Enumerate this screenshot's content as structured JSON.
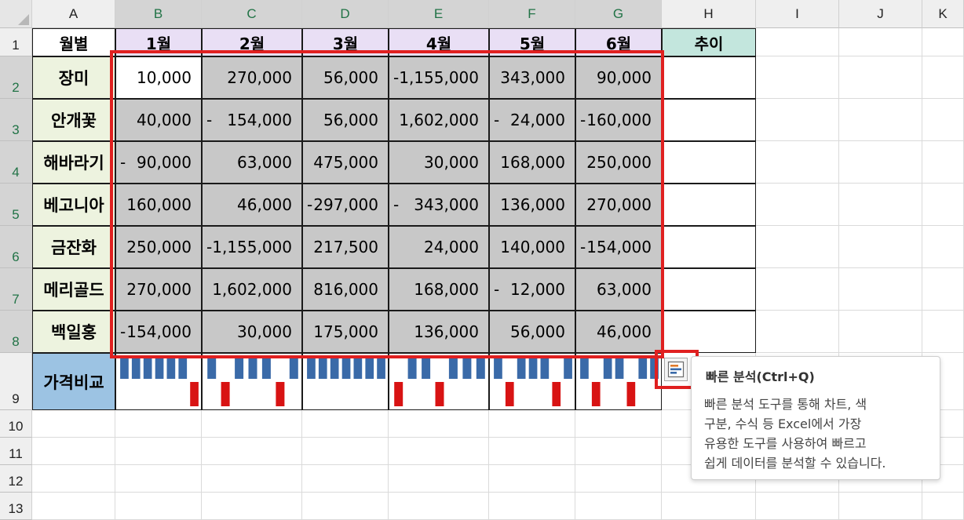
{
  "colors": {
    "selection_outline": "#e02020",
    "month_header_bg": "#e9dff5",
    "trend_header_bg": "#c3e6dd",
    "row_label_bg": "#edf3df",
    "row9_label_bg": "#9cc3e3",
    "data_fill": "#c8c8c8",
    "spark_positive": "#3a6aa8",
    "spark_negative": "#d81313"
  },
  "columns": [
    "A",
    "B",
    "C",
    "D",
    "E",
    "F",
    "G",
    "H",
    "I",
    "J",
    "K"
  ],
  "rows": [
    "1",
    "2",
    "3",
    "4",
    "5",
    "6",
    "7",
    "8",
    "9",
    "10",
    "11",
    "12",
    "13"
  ],
  "header_row": {
    "corner": "월별",
    "months": [
      "1월",
      "2월",
      "3월",
      "4월",
      "5월",
      "6월"
    ],
    "trend": "추이"
  },
  "data_rows": [
    {
      "label": "장미",
      "values": [
        {
          "s": "",
          "v": "10,000"
        },
        {
          "s": "",
          "v": "270,000"
        },
        {
          "s": "",
          "v": "56,000"
        },
        {
          "s": "-",
          "v": "1,155,000"
        },
        {
          "s": "",
          "v": "343,000"
        },
        {
          "s": "",
          "v": "90,000"
        }
      ]
    },
    {
      "label": "안개꽃",
      "values": [
        {
          "s": "",
          "v": "40,000"
        },
        {
          "s": "-",
          "v": "154,000"
        },
        {
          "s": "",
          "v": "56,000"
        },
        {
          "s": "",
          "v": "1,602,000"
        },
        {
          "s": "-",
          "v": "24,000"
        },
        {
          "s": "-",
          "v": "160,000"
        }
      ]
    },
    {
      "label": "해바라기",
      "values": [
        {
          "s": "-",
          "v": "90,000"
        },
        {
          "s": "",
          "v": "63,000"
        },
        {
          "s": "",
          "v": "475,000"
        },
        {
          "s": "",
          "v": "30,000"
        },
        {
          "s": "",
          "v": "168,000"
        },
        {
          "s": "",
          "v": "250,000"
        }
      ]
    },
    {
      "label": "베고니아",
      "values": [
        {
          "s": "",
          "v": "160,000"
        },
        {
          "s": "",
          "v": "46,000"
        },
        {
          "s": "-",
          "v": "297,000"
        },
        {
          "s": "-",
          "v": "343,000"
        },
        {
          "s": "",
          "v": "136,000"
        },
        {
          "s": "",
          "v": "270,000"
        }
      ]
    },
    {
      "label": "금잔화",
      "values": [
        {
          "s": "",
          "v": "250,000"
        },
        {
          "s": "-",
          "v": "1,155,000"
        },
        {
          "s": "",
          "v": "217,500"
        },
        {
          "s": "",
          "v": "24,000"
        },
        {
          "s": "",
          "v": "140,000"
        },
        {
          "s": "-",
          "v": "154,000"
        }
      ]
    },
    {
      "label": "메리골드",
      "values": [
        {
          "s": "",
          "v": "270,000"
        },
        {
          "s": "",
          "v": "1,602,000"
        },
        {
          "s": "",
          "v": "816,000"
        },
        {
          "s": "",
          "v": "168,000"
        },
        {
          "s": "-",
          "v": "12,000"
        },
        {
          "s": "",
          "v": "63,000"
        }
      ]
    },
    {
      "label": "백일홍",
      "values": [
        {
          "s": "-",
          "v": "154,000"
        },
        {
          "s": "",
          "v": "30,000"
        },
        {
          "s": "",
          "v": "175,000"
        },
        {
          "s": "",
          "v": "136,000"
        },
        {
          "s": "",
          "v": "56,000"
        },
        {
          "s": "",
          "v": "46,000"
        }
      ]
    }
  ],
  "row9_label": "가격비교",
  "sparkline_signs": [
    [
      1,
      1,
      1,
      1,
      1,
      1,
      -1
    ],
    [
      1,
      -1,
      1,
      1,
      1,
      -1,
      1
    ],
    [
      1,
      1,
      1,
      1,
      1,
      1,
      1
    ],
    [
      -1,
      1,
      1,
      -1,
      1,
      1,
      1
    ],
    [
      1,
      -1,
      1,
      1,
      1,
      -1,
      1
    ],
    [
      1,
      -1,
      1,
      1,
      -1,
      1,
      1
    ]
  ],
  "quick_analysis": {
    "icon": "quick-analysis-icon",
    "tooltip_title": "빠른 분석(Ctrl+Q)",
    "tooltip_lines": [
      "빠른 분석 도구를 통해 차트, 색",
      "구분, 수식 등 Excel에서 가장",
      "유용한 도구를 사용하여 빠르고",
      "쉽게 데이터를 분석할 수 있습니다."
    ]
  }
}
